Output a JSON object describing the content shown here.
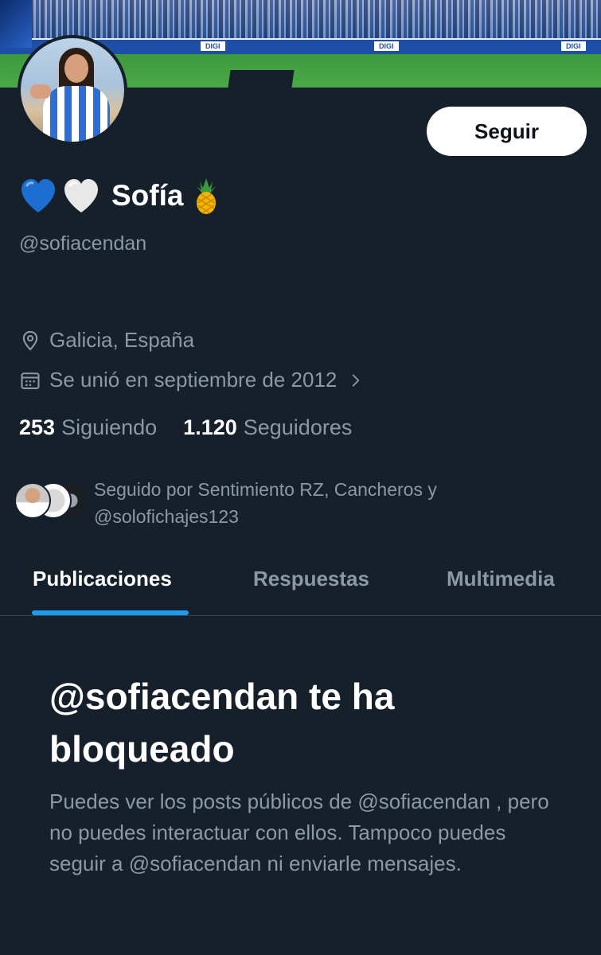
{
  "profile": {
    "display_name": "Sofía",
    "handle": "@sofiacendan",
    "name_emojis": [
      "blue-heart",
      "white-heart",
      "pineapple"
    ],
    "location": "Galicia, España",
    "joined": "Se unió en septiembre de 2012"
  },
  "banner": {
    "ads": [
      "DIGI",
      "DIGI",
      "DIGI"
    ]
  },
  "actions": {
    "follow_label": "Seguir"
  },
  "stats": {
    "following_count": "253",
    "following_label": "Siguiendo",
    "followers_count": "1.120",
    "followers_label": "Seguidores"
  },
  "followed_by": {
    "line1": "Seguido por Sentimiento RZ, Cancheros y",
    "line2": "@solofichajes123"
  },
  "tabs": [
    {
      "label": "Publicaciones",
      "active": true
    },
    {
      "label": "Respuestas",
      "active": false
    },
    {
      "label": "Multimedia",
      "active": false
    }
  ],
  "blocked": {
    "title": "@sofiacendan te ha bloqueado",
    "description": "Puedes ver los posts públicos de @sofiacendan , pero no puedes interactuar con ellos. Tampoco puedes seguir a @sofiacendan ni enviarle mensajes."
  },
  "colors": {
    "background": "#15202b",
    "accent": "#1d9bf0",
    "secondary_text": "#8b98a5",
    "primary_text": "#ffffff"
  },
  "icons": [
    "location-pin-icon",
    "calendar-icon",
    "chevron-right-icon"
  ]
}
